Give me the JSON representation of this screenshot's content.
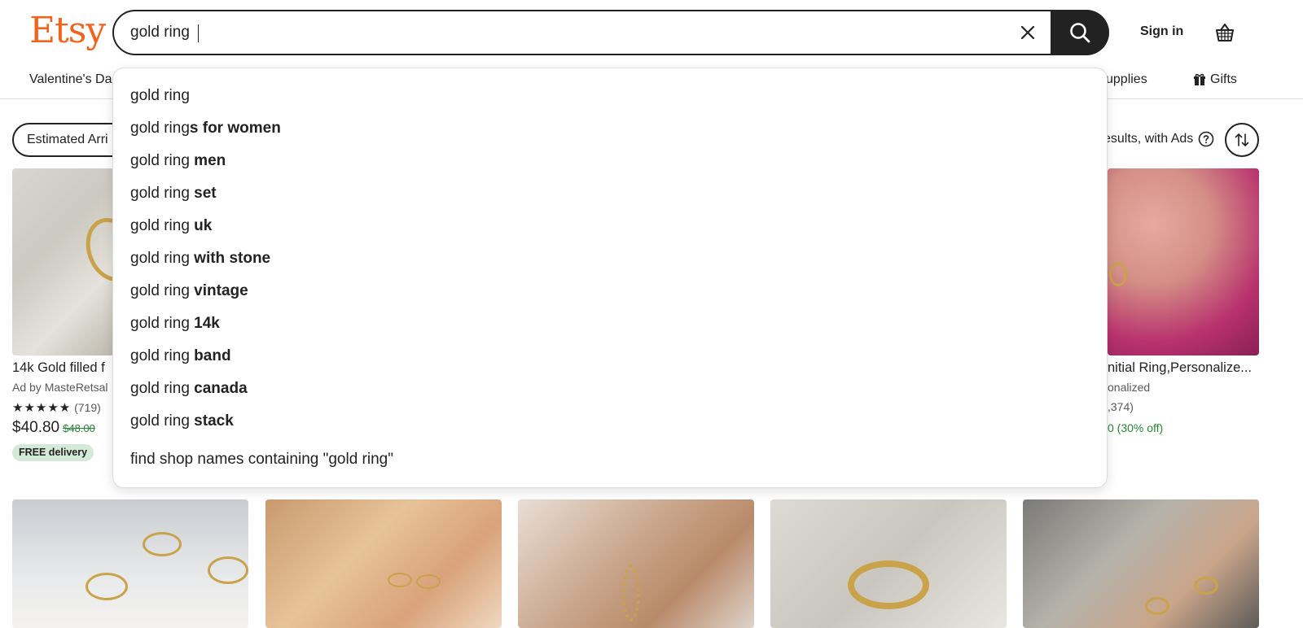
{
  "header": {
    "logo": "Etsy",
    "search_value": "gold ring",
    "sign_in": "Sign in"
  },
  "nav": {
    "valentine": "Valentine's Da",
    "supplies": "upplies",
    "gifts": "Gifts"
  },
  "filters": {
    "estimated_arrival": "Estimated Arri",
    "results_text": "esults, with Ads"
  },
  "listings": [
    {
      "title": "14k Gold filled f",
      "shop": "Ad by MasteRetsal",
      "stars": "★★★★★",
      "reviews": "(719)",
      "price": "$40.80",
      "original_price": "$48.00",
      "badge": "FREE delivery"
    },
    {
      "title": "nitial Ring,Personalize...",
      "shop": "onalized",
      "reviews": ",374)",
      "price_text": "0 (30% off)"
    }
  ],
  "suggestions": [
    {
      "prefix": "gold ring",
      "suffix": ""
    },
    {
      "prefix": "gold ring",
      "suffix": "s for women"
    },
    {
      "prefix": "gold ring ",
      "suffix": "men"
    },
    {
      "prefix": "gold ring ",
      "suffix": "set"
    },
    {
      "prefix": "gold ring ",
      "suffix": "uk"
    },
    {
      "prefix": "gold ring ",
      "suffix": "with stone"
    },
    {
      "prefix": "gold ring ",
      "suffix": "vintage"
    },
    {
      "prefix": "gold ring ",
      "suffix": "14k"
    },
    {
      "prefix": "gold ring ",
      "suffix": "band"
    },
    {
      "prefix": "gold ring ",
      "suffix": "canada"
    },
    {
      "prefix": "gold ring ",
      "suffix": "stack"
    }
  ],
  "shop_search": "find shop names containing \"gold ring\"",
  "colors": {
    "brand": "#F1641E",
    "sale_green": "#258635",
    "badge_bg": "#d4e9d7",
    "dark": "#222222"
  },
  "icons": [
    "clear-icon",
    "search-icon",
    "cart-icon",
    "gift-icon",
    "help-icon",
    "sort-icon"
  ]
}
